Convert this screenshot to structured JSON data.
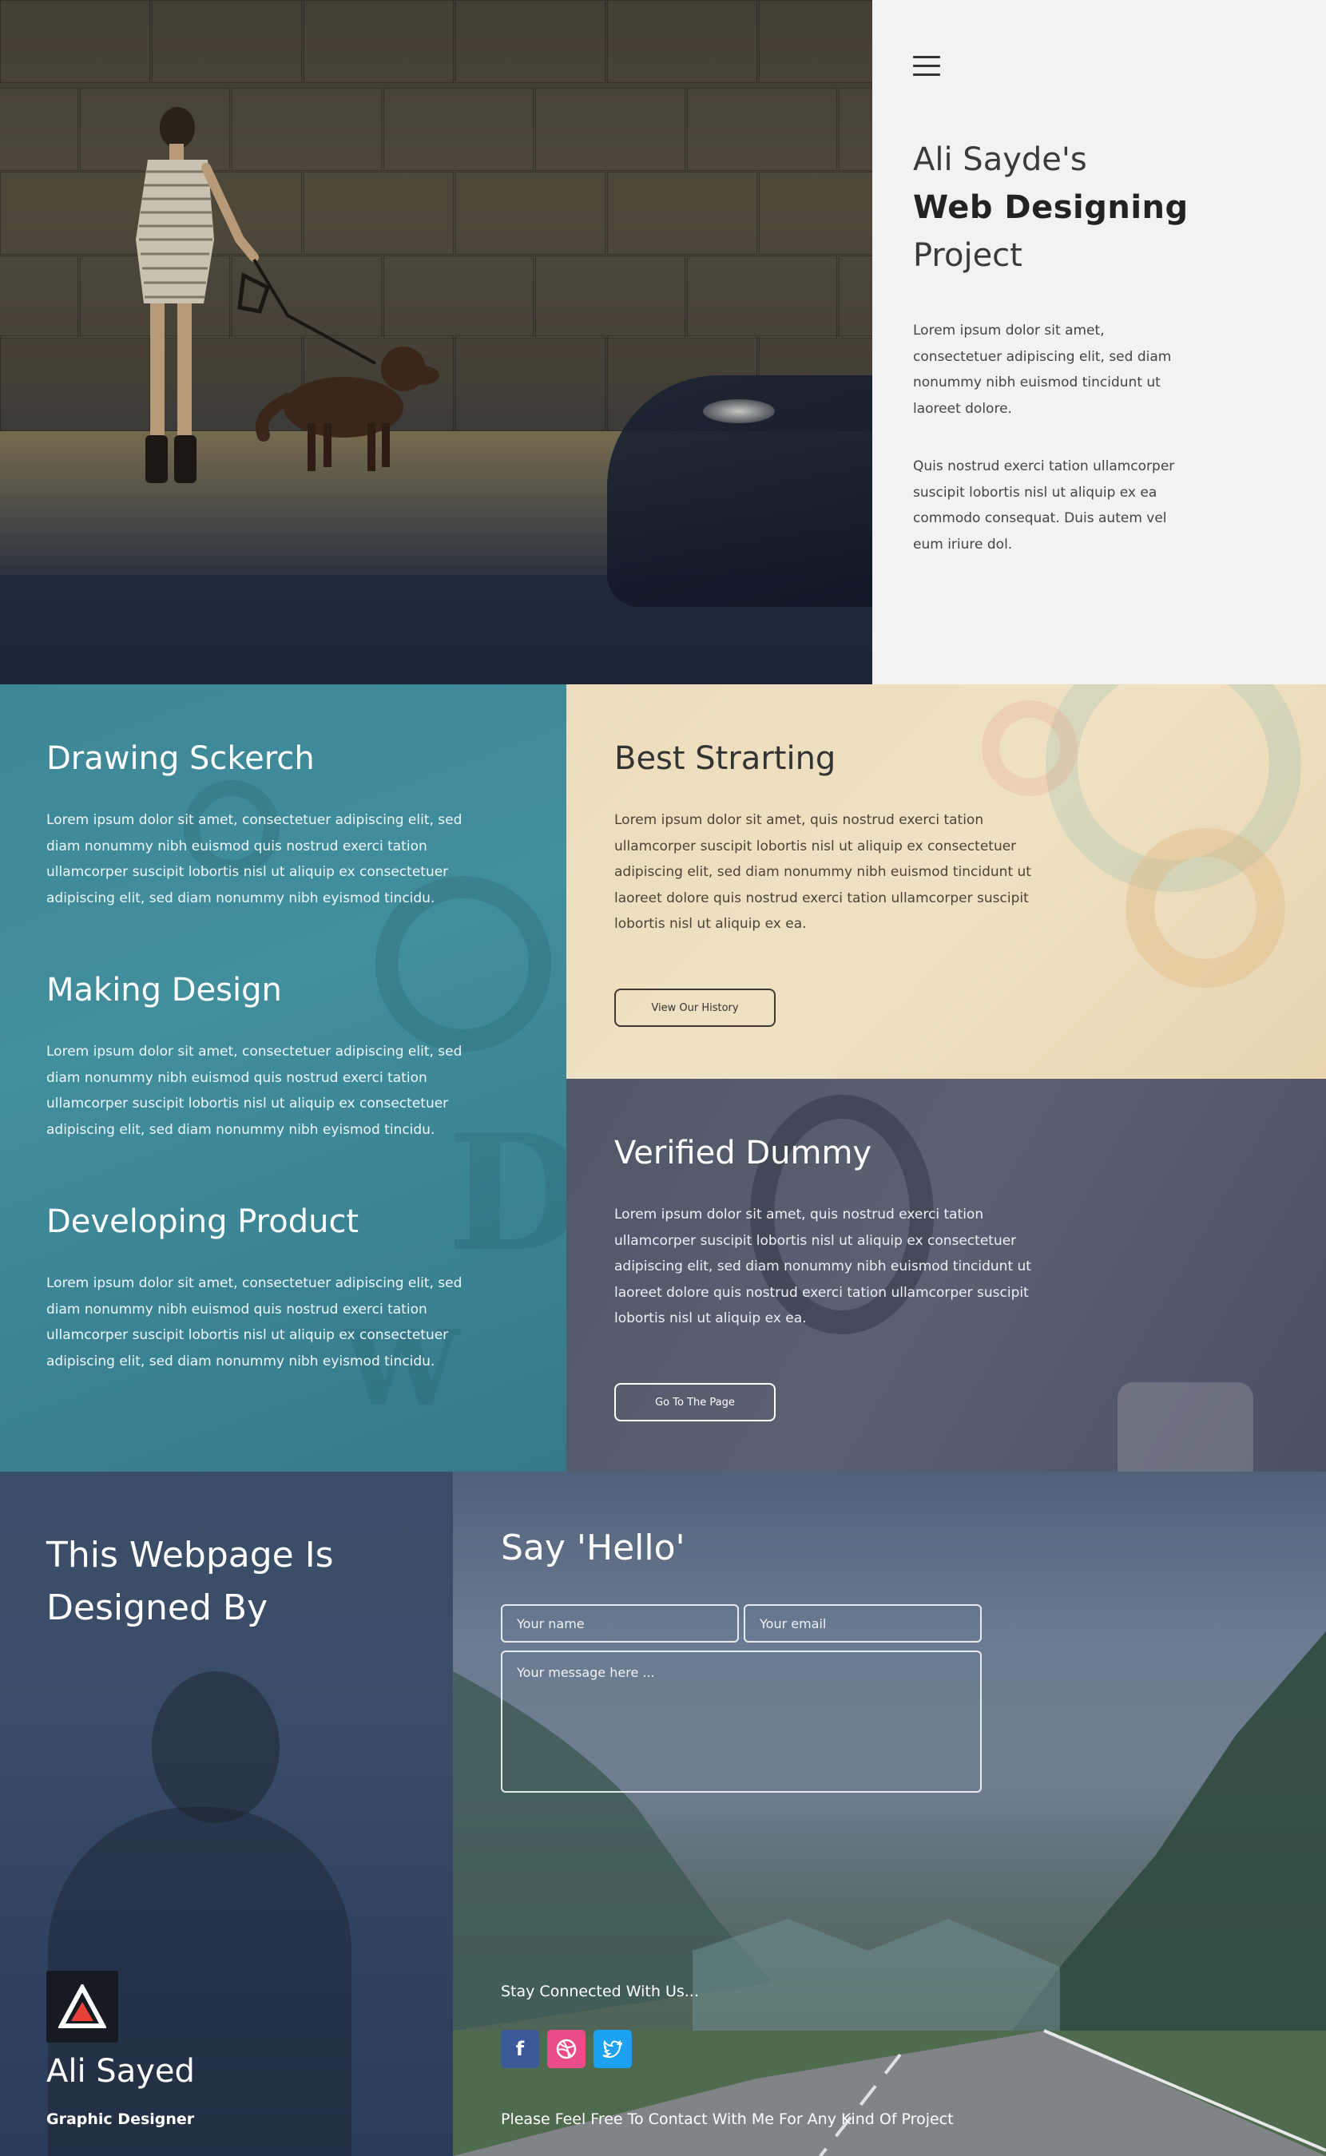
{
  "hero": {
    "title_line1": "Ali Sayde's",
    "title_line2": "Web Designing",
    "title_line3": "Project",
    "paragraph1": "Lorem ipsum dolor sit amet, consectetuer adipiscing elit, sed diam nonummy nibh euismod tincidunt ut laoreet dolore.",
    "paragraph2": "Quis nostrud exerci tation ullamcorper suscipit lobortis nisl ut aliquip ex ea commodo consequat. Duis autem vel eum iriure dol."
  },
  "features": [
    {
      "title": "Drawing Sckerch",
      "text": "Lorem ipsum dolor sit amet, consectetuer adipiscing elit, sed diam nonummy nibh euismod quis nostrud exerci tation ullamcorper suscipit lobortis nisl ut aliquip ex consectetuer adipiscing elit, sed diam nonummy nibh eyismod tincidu."
    },
    {
      "title": "Making Design",
      "text": "Lorem ipsum dolor sit amet, consectetuer adipiscing elit, sed diam nonummy nibh euismod quis nostrud exerci tation ullamcorper suscipit lobortis nisl ut aliquip ex consectetuer adipiscing elit, sed diam nonummy nibh eyismod tincidu."
    },
    {
      "title": "Developing Product",
      "text": "Lorem ipsum dolor sit amet, consectetuer adipiscing elit, sed diam nonummy nibh euismod quis nostrud exerci tation ullamcorper suscipit lobortis nisl ut aliquip ex consectetuer adipiscing elit, sed diam nonummy nibh eyismod tincidu."
    }
  ],
  "best_starting": {
    "title": "Best Strarting",
    "text": "Lorem ipsum dolor sit amet, quis nostrud exerci tation ullamcorper suscipit lobortis nisl ut aliquip ex consectetuer adipiscing elit, sed diam nonummy nibh euismod tincidunt ut laoreet dolore quis nostrud exerci tation ullamcorper suscipit lobortis nisl ut aliquip ex ea.",
    "button": "View Our History"
  },
  "verified": {
    "title": "Verified Dummy",
    "text": "Lorem ipsum dolor sit amet, quis nostrud exerci tation ullamcorper suscipit lobortis nisl ut aliquip ex consectetuer adipiscing elit, sed diam nonummy nibh euismod tincidunt ut laoreet dolore quis nostrud exerci tation ullamcorper suscipit lobortis nisl ut aliquip ex ea.",
    "button": "Go To The Page"
  },
  "designer": {
    "title_line1": "This Webpage Is",
    "title_line2": "Designed By",
    "name": "Ali Sayed",
    "role": "Graphic Designer"
  },
  "contact": {
    "title": "Say 'Hello'",
    "name_placeholder": "Your name",
    "email_placeholder": "Your email",
    "message_placeholder": "Your message here ...",
    "stay_connected": "Stay Connected With Us...",
    "footer": "Please Feel Free To Contact With Me For Any Kind Of Project",
    "social": [
      {
        "icon": "facebook-icon",
        "glyph": "f",
        "color": "#3b5998"
      },
      {
        "icon": "dribbble-icon",
        "glyph": "⊕",
        "color": "#ea4c89"
      },
      {
        "icon": "twitter-icon",
        "glyph": "🐦",
        "color": "#1da1f2"
      }
    ]
  },
  "colors": {
    "teal": "#418e9d",
    "beige": "#efe1c4",
    "slate": "#5a6171",
    "navy": "#3a4d68"
  }
}
